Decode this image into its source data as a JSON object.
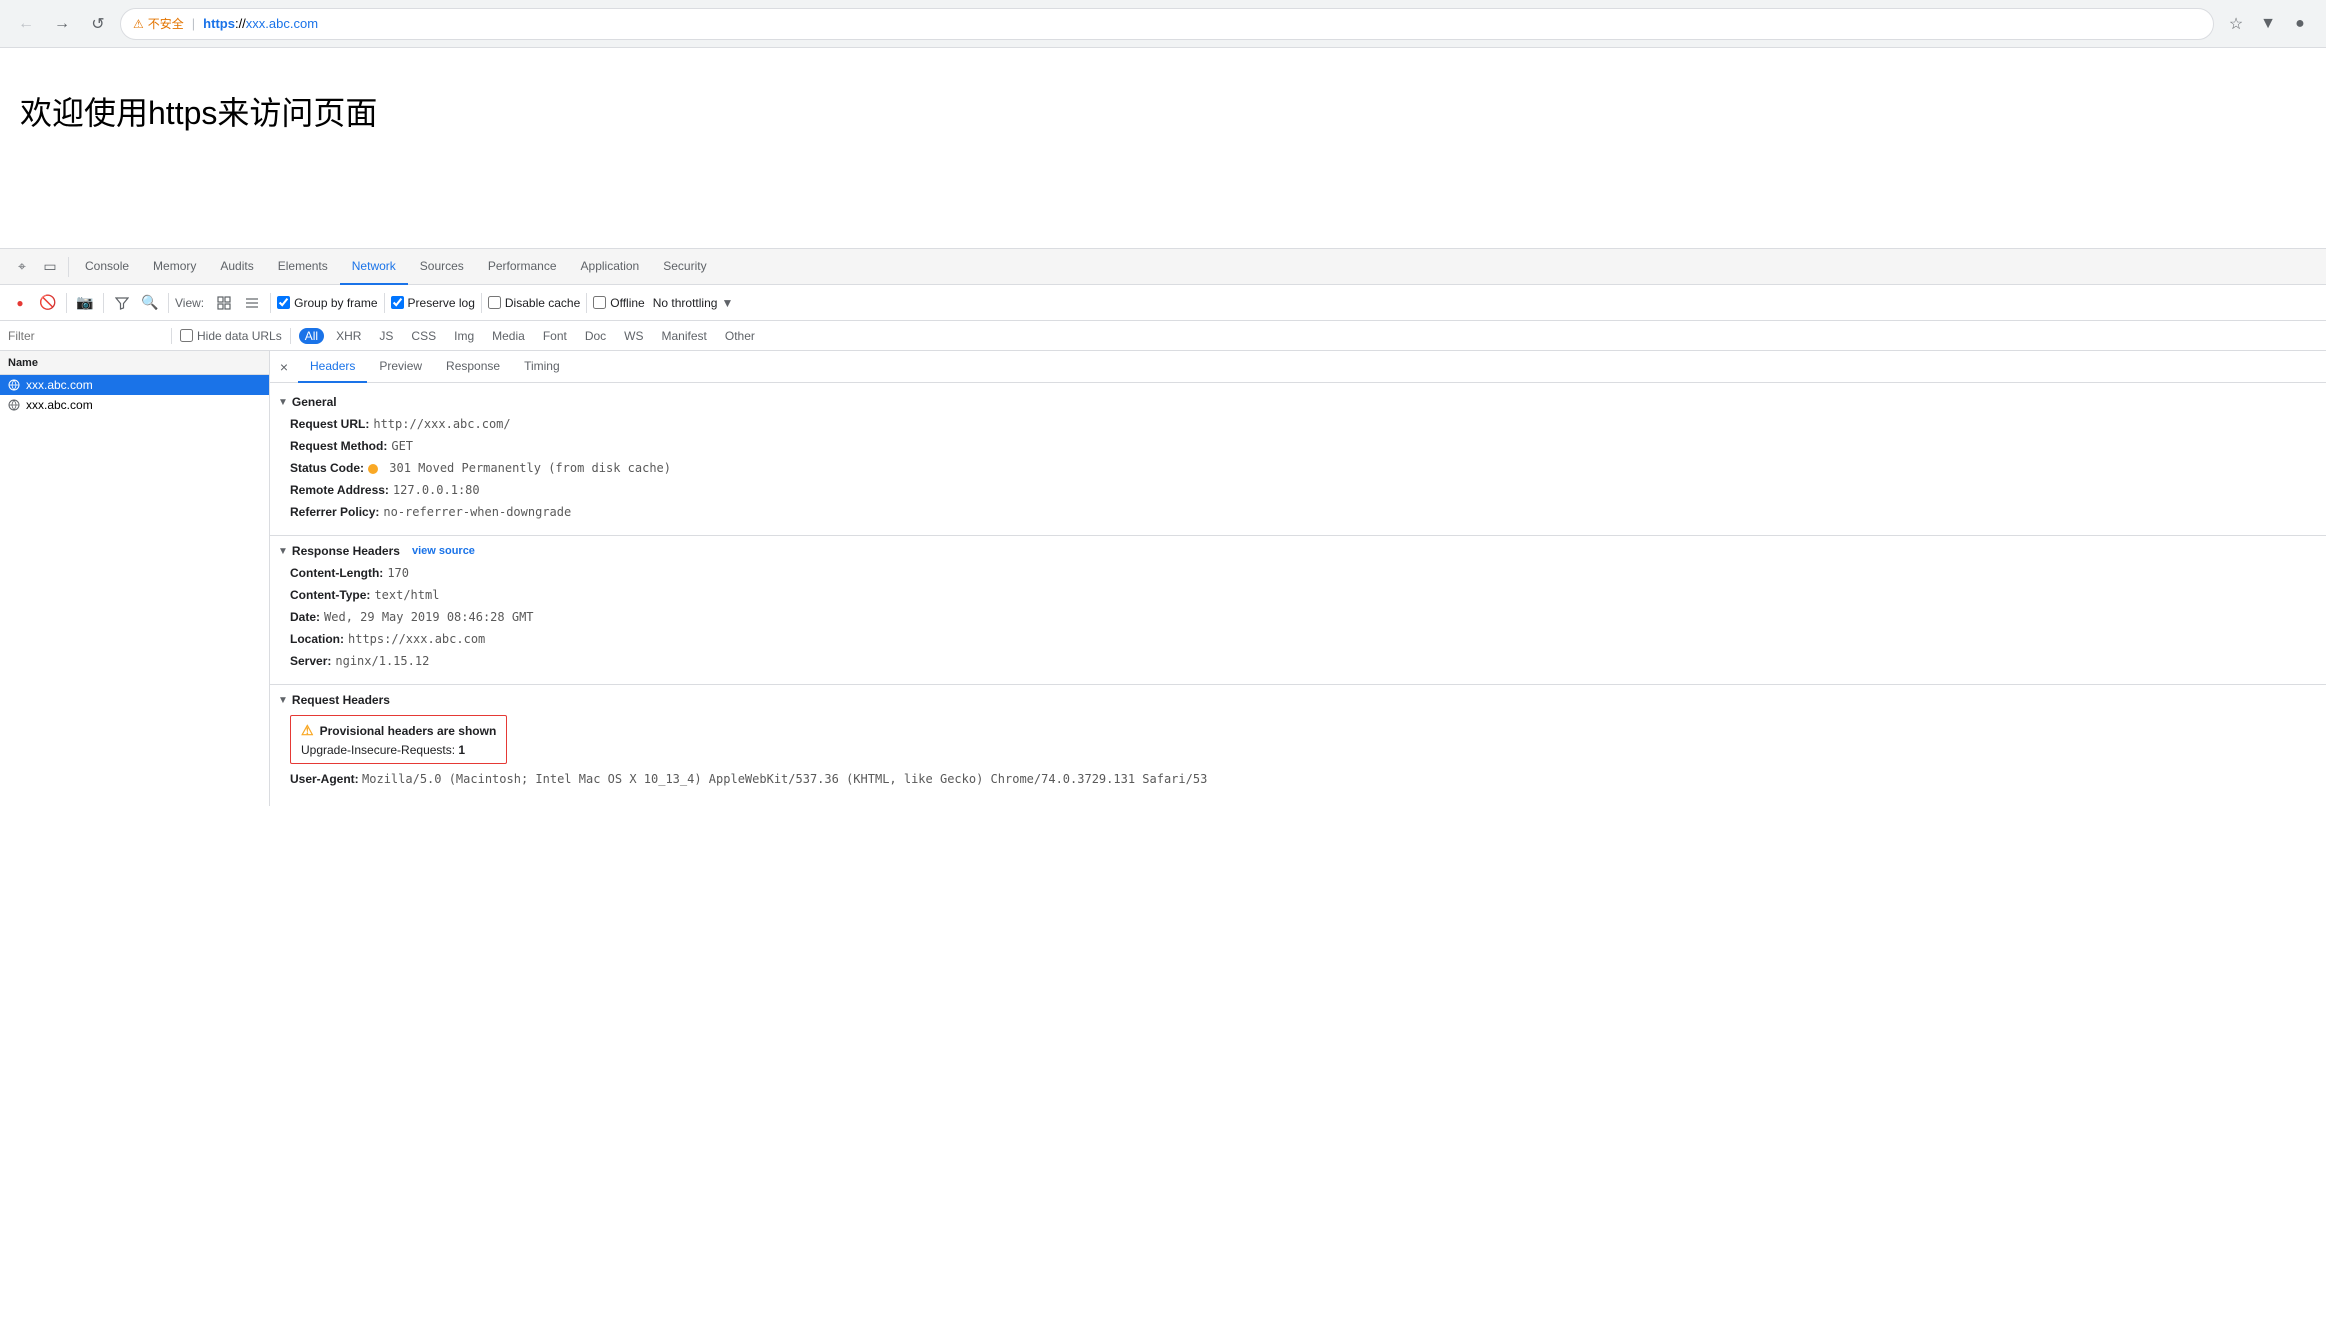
{
  "browser": {
    "back_btn": "←",
    "forward_btn": "→",
    "reload_btn": "↺",
    "security_warning": "⚠",
    "security_text": "不安全",
    "separator": "|",
    "url_scheme": "https://",
    "url_host": "xxx.abc.com",
    "bookmark_icon": "☆",
    "menu_icon": "⋮",
    "profile_icon": "●"
  },
  "page": {
    "title": "欢迎使用https来访问页面"
  },
  "devtools": {
    "tabs": [
      {
        "label": "Console",
        "active": false
      },
      {
        "label": "Memory",
        "active": false
      },
      {
        "label": "Audits",
        "active": false
      },
      {
        "label": "Elements",
        "active": false
      },
      {
        "label": "Network",
        "active": true
      },
      {
        "label": "Sources",
        "active": false
      },
      {
        "label": "Performance",
        "active": false
      },
      {
        "label": "Application",
        "active": false
      },
      {
        "label": "Security",
        "active": false
      }
    ],
    "toolbar": {
      "record_label": "●",
      "clear_label": "🚫",
      "camera_label": "📷",
      "filter_label": "⊻",
      "search_label": "🔍",
      "view_label": "View:",
      "grid_icon": "⊞",
      "list_icon": "≡",
      "group_by_frame_label": "Group by frame",
      "group_by_frame_checked": true,
      "preserve_log_label": "Preserve log",
      "preserve_log_checked": true,
      "disable_cache_label": "Disable cache",
      "disable_cache_checked": false,
      "offline_label": "Offline",
      "offline_checked": false,
      "throttle_label": "No throttling",
      "throttle_arrow": "▼"
    },
    "filter_bar": {
      "placeholder": "Filter",
      "hide_data_urls_label": "Hide data URLs",
      "hide_data_urls_checked": false,
      "types": [
        "All",
        "XHR",
        "JS",
        "CSS",
        "Img",
        "Media",
        "Font",
        "Doc",
        "WS",
        "Manifest",
        "Other"
      ],
      "active_type": "All"
    },
    "network_list": {
      "header": "Name",
      "items": [
        {
          "name": "xxx.abc.com",
          "selected": true,
          "is_folder": false
        },
        {
          "name": "xxx.abc.com",
          "selected": false,
          "is_folder": false
        }
      ]
    },
    "panel_tabs": [
      "×",
      "Headers",
      "Preview",
      "Response",
      "Timing"
    ],
    "active_panel_tab": "Headers",
    "headers": {
      "general": {
        "title": "General",
        "fields": [
          {
            "name": "Request URL:",
            "value": "http://xxx.abc.com/"
          },
          {
            "name": "Request Method:",
            "value": "GET"
          },
          {
            "name": "Status Code:",
            "value": "301 Moved Permanently (from disk cache)",
            "has_dot": true,
            "dot_color": "#f9a825"
          },
          {
            "name": "Remote Address:",
            "value": "127.0.0.1:80"
          },
          {
            "name": "Referrer Policy:",
            "value": "no-referrer-when-downgrade"
          }
        ]
      },
      "response_headers": {
        "title": "Response Headers",
        "view_source_label": "view source",
        "fields": [
          {
            "name": "Content-Length:",
            "value": "170"
          },
          {
            "name": "Content-Type:",
            "value": "text/html"
          },
          {
            "name": "Date:",
            "value": "Wed, 29 May 2019 08:46:28 GMT"
          },
          {
            "name": "Location:",
            "value": "https://xxx.abc.com"
          },
          {
            "name": "Server:",
            "value": "nginx/1.15.12"
          }
        ]
      },
      "request_headers": {
        "title": "Request Headers",
        "warning": {
          "icon": "⚠",
          "text": "Provisional headers are shown",
          "upgrade_name": "Upgrade-Insecure-Requests:",
          "upgrade_value": "1"
        },
        "user_agent": {
          "name": "User-Agent:",
          "value": "Mozilla/5.0 (Macintosh; Intel Mac OS X 10_13_4) AppleWebKit/537.36 (KHTML, like Gecko) Chrome/74.0.3729.131 Safari/53"
        }
      }
    }
  }
}
